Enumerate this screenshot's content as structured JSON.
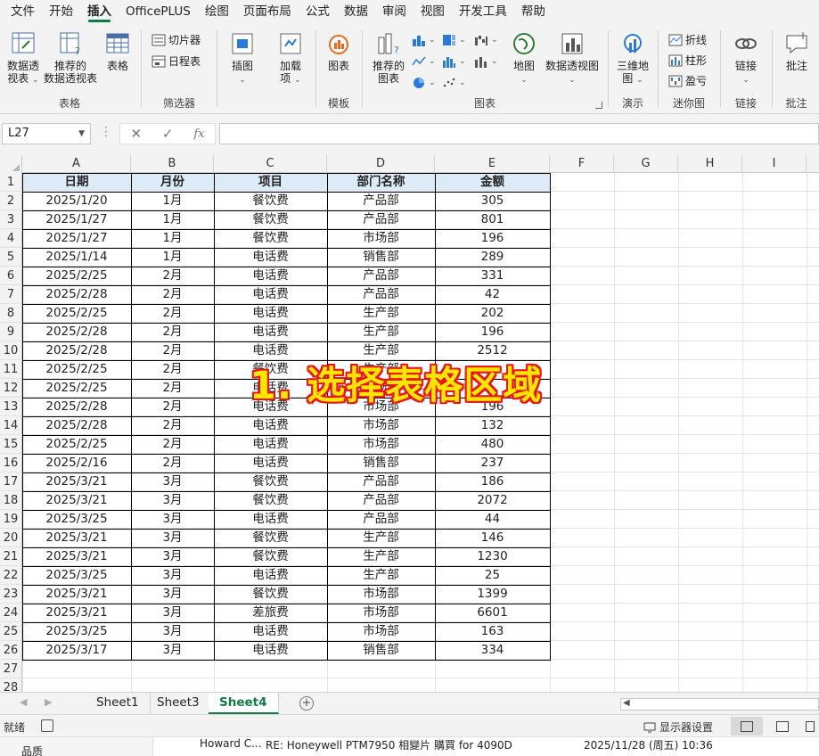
{
  "menu": {
    "tabs": [
      "文件",
      "开始",
      "插入",
      "OfficePLUS",
      "绘图",
      "页面布局",
      "公式",
      "数据",
      "审阅",
      "视图",
      "开发工具",
      "帮助"
    ],
    "active": "插入"
  },
  "ribbon": {
    "tables": {
      "label": "表格",
      "pivot": "数据透视表",
      "pivot_caret": "视表",
      "pivot_line1": "数据透",
      "recommended_pivot_line1": "推荐的",
      "recommended_pivot_line2": "数据透视表",
      "table": "表格"
    },
    "filters": {
      "label": "筛选器",
      "slicer": "切片器",
      "timeline": "日程表"
    },
    "illustrations": {
      "label": "插图"
    },
    "addins": {
      "label_line1": "加载",
      "label_line2": "项"
    },
    "template": {
      "label": "模板",
      "chart_btn": "图表"
    },
    "charts": {
      "label": "图表",
      "recommended_line1": "推荐的",
      "recommended_line2": "图表",
      "map": "地图",
      "pivot_chart": "数据透视图"
    },
    "tours": {
      "label": "演示",
      "map3d_line1": "三维地",
      "map3d_line2": "图"
    },
    "sparklines": {
      "label": "迷你图",
      "line": "折线",
      "column": "柱形",
      "winloss": "盈亏"
    },
    "links": {
      "label": "链接",
      "link_btn": "链接"
    },
    "comments": {
      "label": "批注",
      "comment_btn": "批注"
    }
  },
  "formula_bar": {
    "name_box": "L27",
    "fx": "fx",
    "value": ""
  },
  "columns": [
    "A",
    "B",
    "C",
    "D",
    "E",
    "F",
    "G",
    "H",
    "I"
  ],
  "rows": [
    "1",
    "2",
    "3",
    "4",
    "5",
    "6",
    "7",
    "8",
    "9",
    "10",
    "11",
    "12",
    "13",
    "14",
    "15",
    "16",
    "17",
    "18",
    "19",
    "20",
    "21",
    "22",
    "23",
    "24",
    "25",
    "26",
    "27",
    "28"
  ],
  "table": {
    "headers": [
      "日期",
      "月份",
      "项目",
      "部门名称",
      "金额"
    ],
    "rows": [
      [
        "2025/1/20",
        "1月",
        "餐饮费",
        "产品部",
        "305"
      ],
      [
        "2025/1/27",
        "1月",
        "餐饮费",
        "产品部",
        "801"
      ],
      [
        "2025/1/27",
        "1月",
        "餐饮费",
        "市场部",
        "196"
      ],
      [
        "2025/1/14",
        "1月",
        "电话费",
        "销售部",
        "289"
      ],
      [
        "2025/2/25",
        "2月",
        "电话费",
        "产品部",
        "331"
      ],
      [
        "2025/2/28",
        "2月",
        "电话费",
        "产品部",
        "42"
      ],
      [
        "2025/2/25",
        "2月",
        "电话费",
        "生产部",
        "202"
      ],
      [
        "2025/2/28",
        "2月",
        "电话费",
        "生产部",
        "196"
      ],
      [
        "2025/2/28",
        "2月",
        "电话费",
        "生产部",
        "2512"
      ],
      [
        "2025/2/25",
        "2月",
        "餐饮费",
        "生产部",
        ""
      ],
      [
        "2025/2/25",
        "2月",
        "电话费",
        "市场部",
        ""
      ],
      [
        "2025/2/28",
        "2月",
        "电话费",
        "市场部",
        "196"
      ],
      [
        "2025/2/28",
        "2月",
        "电话费",
        "市场部",
        "132"
      ],
      [
        "2025/2/25",
        "2月",
        "电话费",
        "市场部",
        "480"
      ],
      [
        "2025/2/16",
        "2月",
        "电话费",
        "销售部",
        "237"
      ],
      [
        "2025/3/21",
        "3月",
        "餐饮费",
        "产品部",
        "186"
      ],
      [
        "2025/3/21",
        "3月",
        "餐饮费",
        "产品部",
        "2072"
      ],
      [
        "2025/3/25",
        "3月",
        "电话费",
        "产品部",
        "44"
      ],
      [
        "2025/3/21",
        "3月",
        "餐饮费",
        "生产部",
        "146"
      ],
      [
        "2025/3/21",
        "3月",
        "餐饮费",
        "生产部",
        "1230"
      ],
      [
        "2025/3/25",
        "3月",
        "电话费",
        "生产部",
        "25"
      ],
      [
        "2025/3/21",
        "3月",
        "餐饮费",
        "市场部",
        "1399"
      ],
      [
        "2025/3/21",
        "3月",
        "差旅费",
        "市场部",
        "6601"
      ],
      [
        "2025/3/25",
        "3月",
        "电话费",
        "市场部",
        "163"
      ],
      [
        "2025/3/17",
        "3月",
        "电话费",
        "销售部",
        "334"
      ]
    ]
  },
  "overlay_text": "1. 选择表格区域",
  "sheets": {
    "tabs": [
      "Sheet1",
      "Sheet3",
      "Sheet4"
    ],
    "active": "Sheet4"
  },
  "status": {
    "ready": "就绪",
    "display_settings": "显示器设置"
  },
  "bottom_strip": {
    "folder": "品质",
    "sender": "Howard C...",
    "subject": "RE: Honeywell PTM7950 相變片 購買 for 4090D",
    "date": "2025/11/28 (周五) 10:36"
  },
  "colors": {
    "accent": "#107c41",
    "header_fill": "#ddebf7",
    "overlay_fill": "#ffe600",
    "overlay_stroke": "#e8151b"
  }
}
